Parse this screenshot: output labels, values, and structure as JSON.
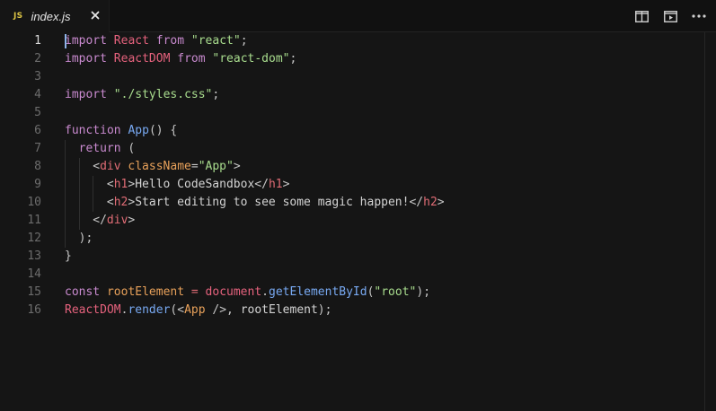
{
  "tab": {
    "icon": "JS",
    "title": "index.js"
  },
  "toolbar": {
    "actions": [
      "split-editor-icon",
      "preview-icon",
      "more-icon"
    ]
  },
  "editor": {
    "active_line": 1,
    "lines": [
      {
        "num": "1",
        "indent": 0,
        "tokens": [
          [
            "kw",
            "import"
          ],
          [
            "pun",
            " "
          ],
          [
            "var",
            "React"
          ],
          [
            "pun",
            " "
          ],
          [
            "kw",
            "from"
          ],
          [
            "pun",
            " "
          ],
          [
            "str",
            "\"react\""
          ],
          [
            "pun",
            ";"
          ]
        ]
      },
      {
        "num": "2",
        "indent": 0,
        "tokens": [
          [
            "kw",
            "import"
          ],
          [
            "pun",
            " "
          ],
          [
            "var",
            "ReactDOM"
          ],
          [
            "pun",
            " "
          ],
          [
            "kw",
            "from"
          ],
          [
            "pun",
            " "
          ],
          [
            "str",
            "\"react-dom\""
          ],
          [
            "pun",
            ";"
          ]
        ]
      },
      {
        "num": "3",
        "indent": 0,
        "tokens": []
      },
      {
        "num": "4",
        "indent": 0,
        "tokens": [
          [
            "kw",
            "import"
          ],
          [
            "pun",
            " "
          ],
          [
            "str",
            "\"./styles.css\""
          ],
          [
            "pun",
            ";"
          ]
        ]
      },
      {
        "num": "5",
        "indent": 0,
        "tokens": []
      },
      {
        "num": "6",
        "indent": 0,
        "tokens": [
          [
            "kw",
            "function"
          ],
          [
            "pun",
            " "
          ],
          [
            "fn",
            "App"
          ],
          [
            "pun",
            "() {"
          ]
        ]
      },
      {
        "num": "7",
        "indent": 1,
        "tokens": [
          [
            "kw",
            "return"
          ],
          [
            "pun",
            " ("
          ]
        ]
      },
      {
        "num": "8",
        "indent": 2,
        "tokens": [
          [
            "pun",
            "<"
          ],
          [
            "tag",
            "div"
          ],
          [
            "pun",
            " "
          ],
          [
            "attr",
            "className"
          ],
          [
            "pun",
            "="
          ],
          [
            "str",
            "\"App\""
          ],
          [
            "pun",
            ">"
          ]
        ]
      },
      {
        "num": "9",
        "indent": 3,
        "tokens": [
          [
            "pun",
            "<"
          ],
          [
            "tag",
            "h1"
          ],
          [
            "pun",
            ">"
          ],
          [
            "txt",
            "Hello CodeSandbox"
          ],
          [
            "pun",
            "</"
          ],
          [
            "tag",
            "h1"
          ],
          [
            "pun",
            ">"
          ]
        ]
      },
      {
        "num": "10",
        "indent": 3,
        "tokens": [
          [
            "pun",
            "<"
          ],
          [
            "tag",
            "h2"
          ],
          [
            "pun",
            ">"
          ],
          [
            "txt",
            "Start editing to see some magic happen!"
          ],
          [
            "pun",
            "</"
          ],
          [
            "tag",
            "h2"
          ],
          [
            "pun",
            ">"
          ]
        ]
      },
      {
        "num": "11",
        "indent": 2,
        "tokens": [
          [
            "pun",
            "</"
          ],
          [
            "tag",
            "div"
          ],
          [
            "pun",
            ">"
          ]
        ]
      },
      {
        "num": "12",
        "indent": 1,
        "tokens": [
          [
            "pun",
            ");"
          ]
        ]
      },
      {
        "num": "13",
        "indent": 0,
        "tokens": [
          [
            "pun",
            "}"
          ]
        ]
      },
      {
        "num": "14",
        "indent": 0,
        "tokens": []
      },
      {
        "num": "15",
        "indent": 0,
        "tokens": [
          [
            "kw",
            "const"
          ],
          [
            "pun",
            " "
          ],
          [
            "attr",
            "rootElement"
          ],
          [
            "pun",
            " "
          ],
          [
            "op",
            "="
          ],
          [
            "pun",
            " "
          ],
          [
            "var",
            "document"
          ],
          [
            "pun",
            "."
          ],
          [
            "fn",
            "getElementById"
          ],
          [
            "pun",
            "("
          ],
          [
            "str",
            "\"root\""
          ],
          [
            "pun",
            ");"
          ]
        ]
      },
      {
        "num": "16",
        "indent": 0,
        "tokens": [
          [
            "var",
            "ReactDOM"
          ],
          [
            "pun",
            "."
          ],
          [
            "fn",
            "render"
          ],
          [
            "pun",
            "(<"
          ],
          [
            "attr",
            "App"
          ],
          [
            "pun",
            " />, "
          ],
          [
            "txt",
            "rootElement"
          ],
          [
            "pun",
            ");"
          ]
        ]
      }
    ]
  },
  "colors": {
    "background": "#151515",
    "keyword": "#c98acf",
    "string": "#a9dd8e",
    "function": "#78a9f2",
    "tag": "#e06c75",
    "attribute": "#e8a15a"
  }
}
